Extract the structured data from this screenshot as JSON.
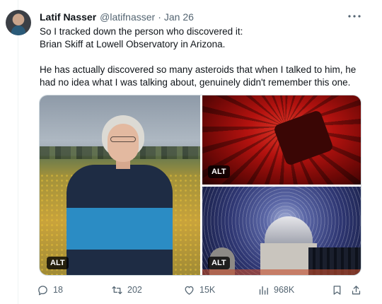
{
  "tweet": {
    "author_name": "Latif Nasser",
    "handle": "@latifnasser",
    "separator": "·",
    "date": "Jan 26",
    "text_lines": [
      "So I tracked down the person who discovered it:",
      "Brian Skiff at Lowell Observatory in Arizona.",
      "He has actually discovered so many asteroids that when I talked to him, he",
      "had no idea what I was talking about, genuinely didn't remember this one."
    ],
    "more_icon": "ellipsis-icon"
  },
  "media": {
    "images": [
      {
        "name": "portrait-photo",
        "alt_badge": "ALT"
      },
      {
        "name": "red-dome-photo",
        "alt_badge": "ALT"
      },
      {
        "name": "star-trails-photo",
        "alt_badge": "ALT"
      }
    ]
  },
  "actions": {
    "reply": {
      "icon": "reply-icon",
      "count": "18"
    },
    "retweet": {
      "icon": "retweet-icon",
      "count": "202"
    },
    "like": {
      "icon": "heart-icon",
      "count": "15K"
    },
    "views": {
      "icon": "analytics-icon",
      "count": "968K"
    },
    "bookmark": {
      "icon": "bookmark-icon"
    },
    "share": {
      "icon": "share-icon"
    }
  },
  "colors": {
    "text": "#0f1419",
    "secondary": "#536471",
    "border": "#cfd9de"
  }
}
